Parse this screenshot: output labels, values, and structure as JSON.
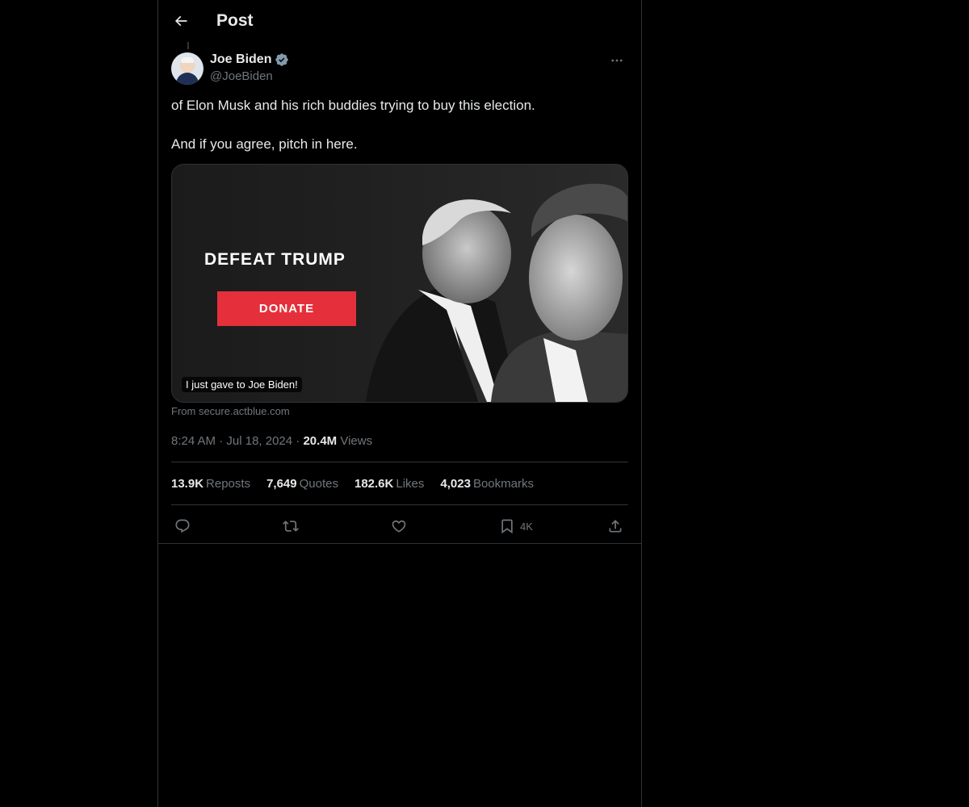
{
  "header": {
    "title": "Post"
  },
  "author": {
    "name": "Joe Biden",
    "handle": "@JoeBiden"
  },
  "post": {
    "line1": "of Elon Musk and his rich buddies trying to buy this election.",
    "line2": "And if you agree, pitch in here."
  },
  "card": {
    "headline": "DEFEAT TRUMP",
    "button_label": "DONATE",
    "badge": "I just gave to Joe Biden!",
    "source": "From secure.actblue.com"
  },
  "meta": {
    "time": "8:24 AM",
    "date": "Jul 18, 2024",
    "views_count": "20.4M",
    "views_label": "Views"
  },
  "stats": [
    {
      "num": "13.9K",
      "label": "Reposts"
    },
    {
      "num": "7,649",
      "label": "Quotes"
    },
    {
      "num": "182.6K",
      "label": "Likes"
    },
    {
      "num": "4,023",
      "label": "Bookmarks"
    }
  ],
  "actions": {
    "bookmark_count": "4K"
  },
  "colors": {
    "background": "#000000",
    "text": "#e7e9ea",
    "muted": "#71767b",
    "border": "#2f3336",
    "verified": "#829aab",
    "donate": "#e5303b"
  },
  "icons": [
    "back-arrow-icon",
    "verified-badge-icon",
    "more-icon",
    "reply-icon",
    "repost-icon",
    "like-icon",
    "bookmark-icon",
    "share-icon"
  ]
}
